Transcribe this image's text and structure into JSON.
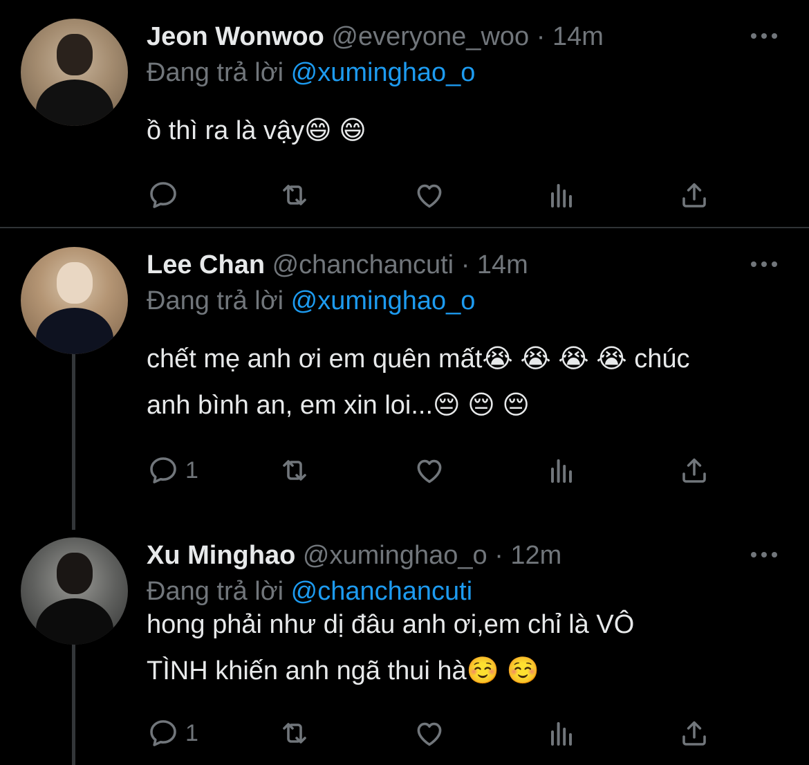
{
  "tweets": [
    {
      "name": "Jeon Wonwoo",
      "handle": "@everyone_woo",
      "time": "14m",
      "replying_prefix": "Đang trả lời",
      "replying_to": "@xuminghao_o",
      "lines": [
        "ồ thì ra là vậy😄 😄"
      ],
      "reply_count": ""
    },
    {
      "name": "Lee Chan",
      "handle": "@chanchancuti",
      "time": "14m",
      "replying_prefix": "Đang trả lời",
      "replying_to": "@xuminghao_o",
      "lines": [
        "chết mẹ anh ơi em quên mất😭 😭 😭 😭 chúc",
        "anh bình an, em xin loi...😔 😔 😔"
      ],
      "reply_count": "1"
    },
    {
      "name": "Xu Minghao",
      "handle": "@xuminghao_o",
      "time": "12m",
      "replying_prefix": "Đang trả lời",
      "replying_to": "@chanchancuti",
      "lines": [
        "hong phải như dị đâu anh ơi,em chỉ là VÔ",
        "TÌNH khiến anh ngã thui hà☺️ ☺️"
      ],
      "reply_count": "1"
    }
  ],
  "separator": "·",
  "icons": {
    "reply": "reply-icon",
    "retweet": "retweet-icon",
    "like": "heart-icon",
    "views": "views-icon",
    "share": "share-icon",
    "more": "more-icon"
  },
  "colors": {
    "background": "#000000",
    "text": "#e7e9ea",
    "muted": "#71767b",
    "link": "#1d9bf0",
    "divider": "#2f3336"
  }
}
